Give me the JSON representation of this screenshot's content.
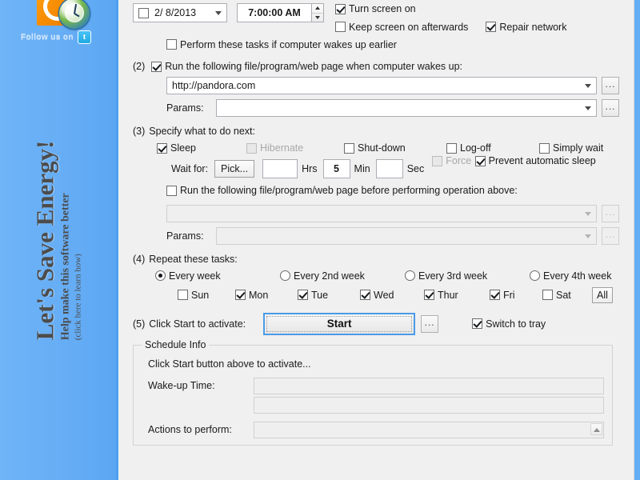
{
  "sidebar": {
    "logo_name": "app-logo-clock",
    "follow_text": "Follow us on",
    "twitter_glyph": "t",
    "vertical_title": "Let's Save Energy!",
    "vertical_sub": "Help make this software better",
    "vertical_sub2": "(click here to learn how)"
  },
  "step1": {
    "date_value": "2/ 8/2013",
    "time_value": "7:00:00 AM",
    "turn_screen_on": "Turn screen on",
    "keep_screen_on": "Keep screen on afterwards",
    "repair_network": "Repair network",
    "perform_if_earlier": "Perform these tasks if computer wakes up earlier"
  },
  "step2": {
    "number": "(2)",
    "title": "Run the following file/program/web page when computer wakes up:",
    "url_value": "http://pandora.com",
    "params_label": "Params:",
    "params_value": "",
    "browse_label": "..."
  },
  "step3": {
    "number": "(3)",
    "title": "Specify what to do next:",
    "options": [
      {
        "label": "Sleep",
        "checked": true,
        "disabled": false
      },
      {
        "label": "Hibernate",
        "checked": false,
        "disabled": true
      },
      {
        "label": "Shut-down",
        "checked": false,
        "disabled": false
      },
      {
        "label": "Log-off",
        "checked": false,
        "disabled": false
      },
      {
        "label": "Simply wait",
        "checked": false,
        "disabled": false
      }
    ],
    "wait_for_label": "Wait for:",
    "pick_label": "Pick...",
    "hrs_value": "",
    "hrs_label": "Hrs",
    "min_value": "5",
    "min_label": "Min",
    "sec_value": "",
    "sec_label": "Sec",
    "force_label": "Force",
    "prevent_sleep_label": "Prevent automatic sleep",
    "run_before_label": "Run the following file/program/web page before performing operation above:",
    "prog_value": "",
    "params_label": "Params:",
    "params_value": ""
  },
  "step4": {
    "number": "(4)",
    "title": "Repeat these tasks:",
    "repeat_options": [
      {
        "label": "Every week",
        "selected": true
      },
      {
        "label": "Every 2nd week",
        "selected": false
      },
      {
        "label": "Every 3rd week",
        "selected": false
      },
      {
        "label": "Every 4th week",
        "selected": false
      }
    ],
    "days": [
      {
        "label": "Sun",
        "checked": false
      },
      {
        "label": "Mon",
        "checked": true
      },
      {
        "label": "Tue",
        "checked": true
      },
      {
        "label": "Wed",
        "checked": true
      },
      {
        "label": "Thur",
        "checked": true
      },
      {
        "label": "Fri",
        "checked": true
      },
      {
        "label": "Sat",
        "checked": false
      }
    ],
    "all_label": "All"
  },
  "step5": {
    "number": "(5)",
    "title": "Click Start to activate:",
    "start_label": "Start",
    "more_label": "...",
    "switch_to_tray": "Switch to tray"
  },
  "schedule_info": {
    "group_title": "Schedule Info",
    "status_text": "Click Start button above to activate...",
    "wakeup_label": "Wake-up Time:",
    "wakeup_value": "",
    "wakeup_value2": "",
    "actions_label": "Actions to perform:",
    "actions_value": ""
  },
  "colors": {
    "sidebar_blue": "#64aef5",
    "logo_orange": "#f58a00",
    "panel_gray": "#f0f0f0",
    "focus_blue": "#4a9ae6"
  }
}
